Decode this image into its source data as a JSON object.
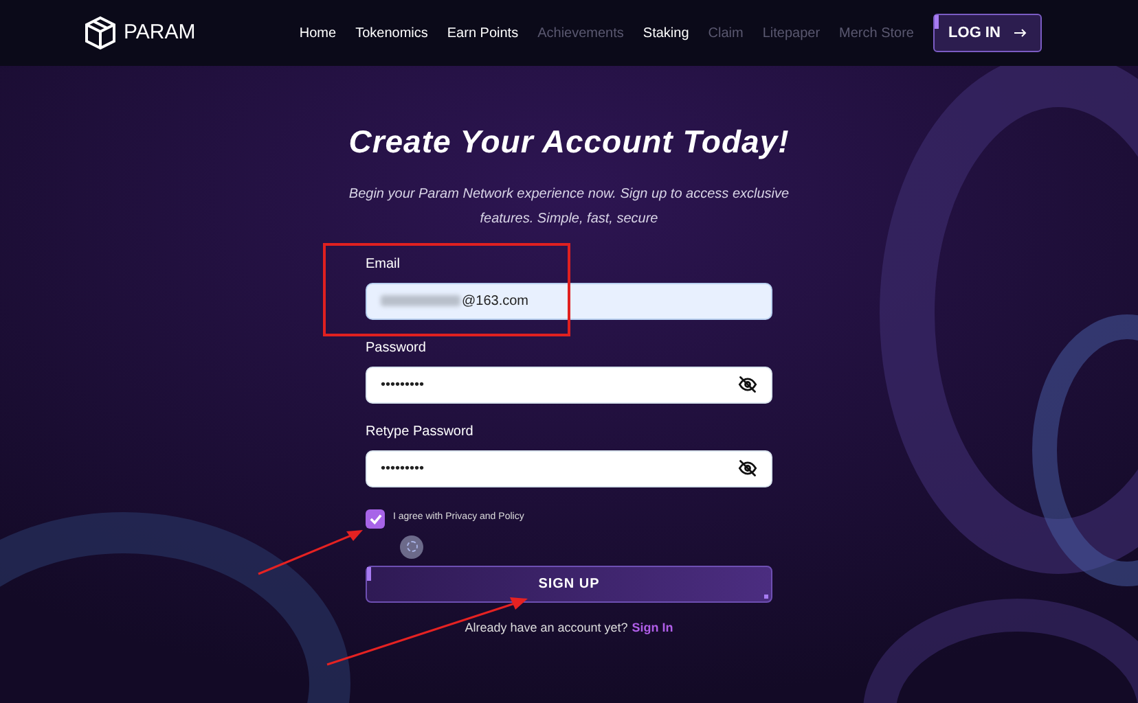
{
  "header": {
    "logo_text": "PARAM",
    "nav": [
      {
        "label": "Home",
        "disabled": false
      },
      {
        "label": "Tokenomics",
        "disabled": false
      },
      {
        "label": "Earn Points",
        "disabled": false
      },
      {
        "label": "Achievements",
        "disabled": true
      },
      {
        "label": "Staking",
        "disabled": false
      },
      {
        "label": "Claim",
        "disabled": true
      },
      {
        "label": "Litepaper",
        "disabled": true
      },
      {
        "label": "Merch Store",
        "disabled": true
      }
    ],
    "login_button": "LOG IN"
  },
  "title": "Create Your Account Today!",
  "subtitle": "Begin your Param Network experience now. Sign up to access exclusive features. Simple, fast, secure",
  "fields": [
    {
      "label": "Email",
      "value": "@163.com",
      "kind": "email",
      "focused": true
    },
    {
      "label": "Password",
      "value": "•••••••••",
      "kind": "password",
      "focused": false
    },
    {
      "label": "Retype Password",
      "value": "•••••••••",
      "kind": "password",
      "focused": false
    }
  ],
  "agree": {
    "label": "I agree with Privacy and Policy",
    "checked": true
  },
  "signup_button": "SIGN UP",
  "footer": {
    "text": "Already have an account yet?",
    "link": "Sign In"
  }
}
